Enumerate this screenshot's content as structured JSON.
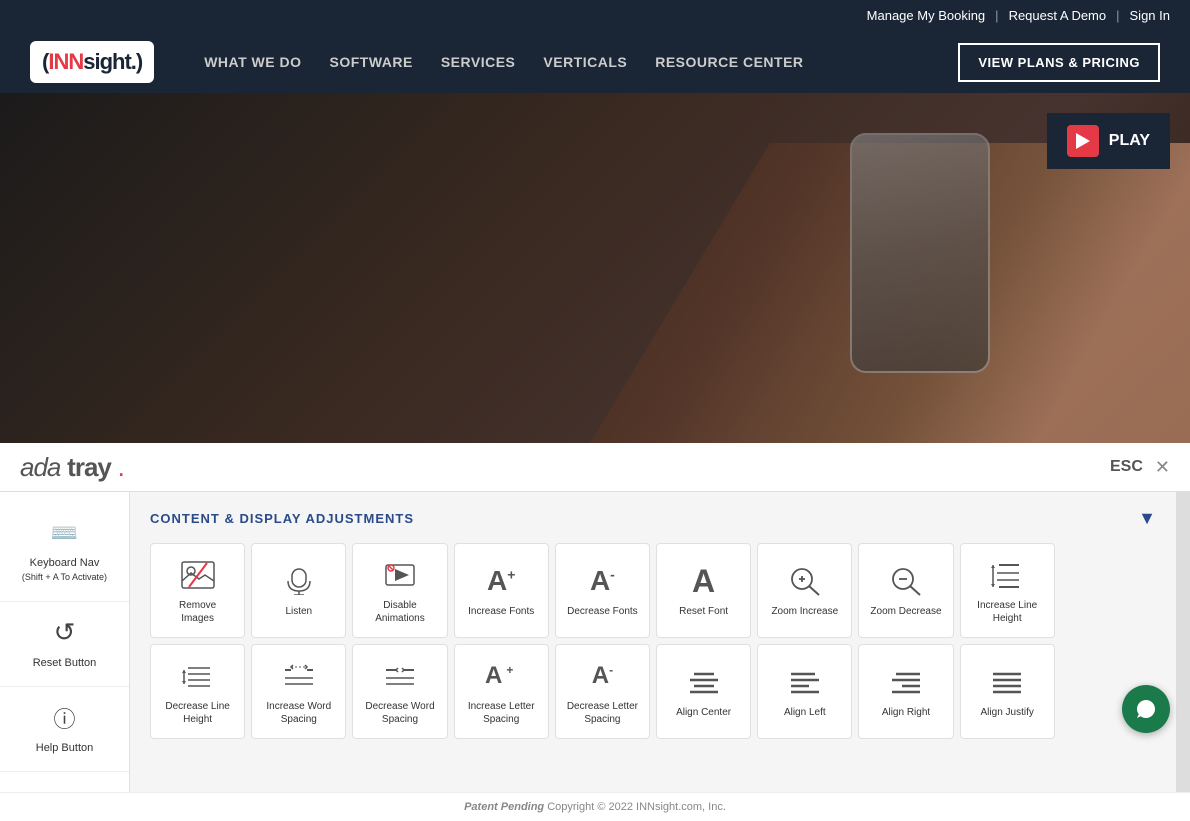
{
  "topbar": {
    "links": [
      "Manage My Booking",
      "Request A Demo",
      "Sign In"
    ],
    "divider": "|"
  },
  "nav": {
    "logo_inn": "INN",
    "logo_sight": "sight.",
    "links": [
      "WHAT WE DO",
      "SOFTWARE",
      "SERVICES",
      "VERTICALS",
      "RESOURCE CENTER"
    ],
    "cta": "VIEW PLANS & PRICING"
  },
  "hero": {
    "play_label": "PLAY"
  },
  "ada_bar": {
    "logo": "ada tray.",
    "esc_label": "ESC",
    "close_symbol": "✕"
  },
  "panel": {
    "section_title": "CONTENT & DISPLAY ADJUSTMENTS",
    "collapse_icon": "▼"
  },
  "sidebar": {
    "items": [
      {
        "label": "Keyboard Nav\n(Shift + A To Activate)",
        "icon": "⌨"
      },
      {
        "label": "Reset Button",
        "icon": "↺"
      },
      {
        "label": "Help Button",
        "icon": "ⓘ"
      }
    ]
  },
  "buttons_row1": [
    {
      "label": "Remove Images",
      "icon": "🖼"
    },
    {
      "label": "Listen",
      "icon": "🔊"
    },
    {
      "label": "Disable Animations",
      "icon": "🎬"
    },
    {
      "label": "Increase Fonts",
      "icon": "A+"
    },
    {
      "label": "Decrease Fonts",
      "icon": "A-"
    },
    {
      "label": "Reset Font",
      "icon": "A"
    },
    {
      "label": "Zoom Increase",
      "icon": "🔍+"
    },
    {
      "label": "Zoom Decrease",
      "icon": "🔍-"
    },
    {
      "label": "Increase Line Height",
      "icon": "≡↕"
    },
    {
      "label": "",
      "icon": ""
    }
  ],
  "buttons_row2": [
    {
      "label": "Decrease Line Height",
      "icon": "≡↓"
    },
    {
      "label": "Increase Word Spacing",
      "icon": "⇔+"
    },
    {
      "label": "Decrease Word Spacing",
      "icon": "⇔-"
    },
    {
      "label": "Increase Letter Spacing",
      "icon": "A+"
    },
    {
      "label": "Decrease Letter Spacing",
      "icon": "A-"
    },
    {
      "label": "Align Center",
      "icon": "☰c"
    },
    {
      "label": "Align Left",
      "icon": "☰l"
    },
    {
      "label": "Align Right",
      "icon": "☰r"
    },
    {
      "label": "Align Justify",
      "icon": "☰j"
    },
    {
      "label": "",
      "icon": ""
    }
  ],
  "footer": {
    "patent": "Patent Pending",
    "copyright": "Copyright © 2022 INNsight.com, Inc."
  }
}
